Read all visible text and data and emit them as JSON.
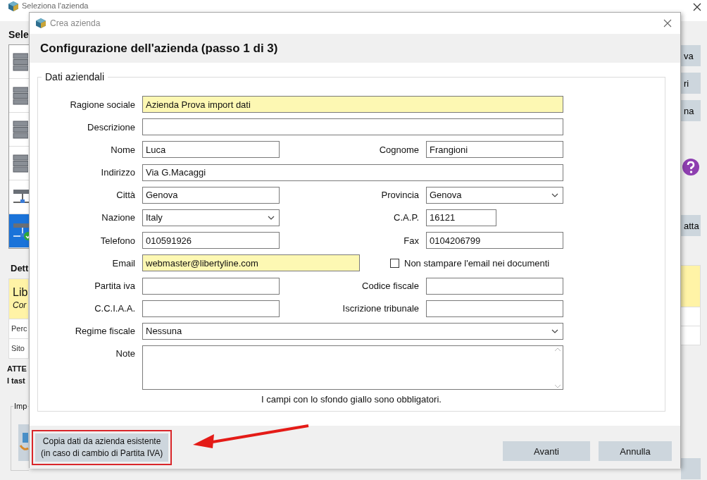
{
  "background_window": {
    "title": "Seleziona l'azienda",
    "heading": "Sele",
    "list_items": [
      {
        "kind": "database",
        "selected": false
      },
      {
        "kind": "database",
        "selected": false
      },
      {
        "kind": "database",
        "selected": false
      },
      {
        "kind": "database",
        "selected": false
      },
      {
        "kind": "network",
        "selected": false
      },
      {
        "kind": "network",
        "selected": true
      }
    ],
    "details_heading": "Dett",
    "details_title": "Lib",
    "details_subtitle": "Cor",
    "details_rows": [
      "Perc",
      "Sito"
    ],
    "warning_lines": [
      "ATTE",
      "I tast"
    ],
    "group_label": "Imp",
    "right_buttons": [
      "va",
      "ri",
      "na"
    ],
    "right_button_lower": "atta"
  },
  "dialog": {
    "title": "Crea azienda",
    "heading": "Configurazione dell'azienda (passo 1 di 3)",
    "group_label": "Dati aziendali",
    "rows": [
      {
        "items": [
          {
            "kind": "text",
            "label": "Ragione sociale",
            "value": "Azienda Prova import dati",
            "required": true
          }
        ]
      },
      {
        "items": [
          {
            "kind": "text",
            "label": "Descrizione",
            "value": "",
            "required": false
          }
        ]
      },
      {
        "items": [
          {
            "kind": "text",
            "label": "Nome",
            "value": "Luca",
            "required": false
          },
          {
            "kind": "text",
            "label": "Cognome",
            "value": "Frangioni",
            "required": false
          }
        ]
      },
      {
        "items": [
          {
            "kind": "text",
            "label": "Indirizzo",
            "value": "Via G.Macaggi",
            "required": false
          }
        ]
      },
      {
        "items": [
          {
            "kind": "text",
            "label": "Città",
            "value": "Genova",
            "required": false
          },
          {
            "kind": "select",
            "label": "Provincia",
            "value": "Genova",
            "required": false
          }
        ]
      },
      {
        "items": [
          {
            "kind": "select",
            "label": "Nazione",
            "value": "Italy",
            "required": false
          },
          {
            "kind": "short",
            "label": "C.A.P.",
            "value": "16121",
            "required": false
          }
        ]
      },
      {
        "items": [
          {
            "kind": "text",
            "label": "Telefono",
            "value": "010591926",
            "required": false
          },
          {
            "kind": "text",
            "label": "Fax",
            "value": "0104206799",
            "required": false
          }
        ]
      },
      {
        "items": [
          {
            "kind": "wide",
            "label": "Email",
            "value": "webmaster@libertyline.com",
            "required": true
          },
          {
            "kind": "checkbox",
            "label": "Non stampare l'email nei documenti",
            "checked": false
          }
        ]
      },
      {
        "items": [
          {
            "kind": "text",
            "label": "Partita iva",
            "value": "",
            "required": false
          },
          {
            "kind": "text",
            "label": "Codice fiscale",
            "value": "",
            "required": false
          }
        ]
      },
      {
        "items": [
          {
            "kind": "text",
            "label": "C.C.I.A.A.",
            "value": "",
            "required": false
          },
          {
            "kind": "text",
            "label": "Iscrizione tribunale",
            "value": "",
            "required": false
          }
        ]
      },
      {
        "items": [
          {
            "kind": "select",
            "label": "Regime fiscale",
            "value": "Nessuna",
            "required": false
          }
        ]
      },
      {
        "items": [
          {
            "kind": "textarea",
            "label": "Note",
            "value": "",
            "required": false
          }
        ]
      }
    ],
    "footnote": "I campi con lo sfondo giallo sono obbligatori.",
    "copy_button": [
      "Copia dati da azienda esistente",
      "(in caso di cambio di Partita IVA)"
    ],
    "next_button": "Avanti",
    "cancel_button": "Annulla"
  }
}
